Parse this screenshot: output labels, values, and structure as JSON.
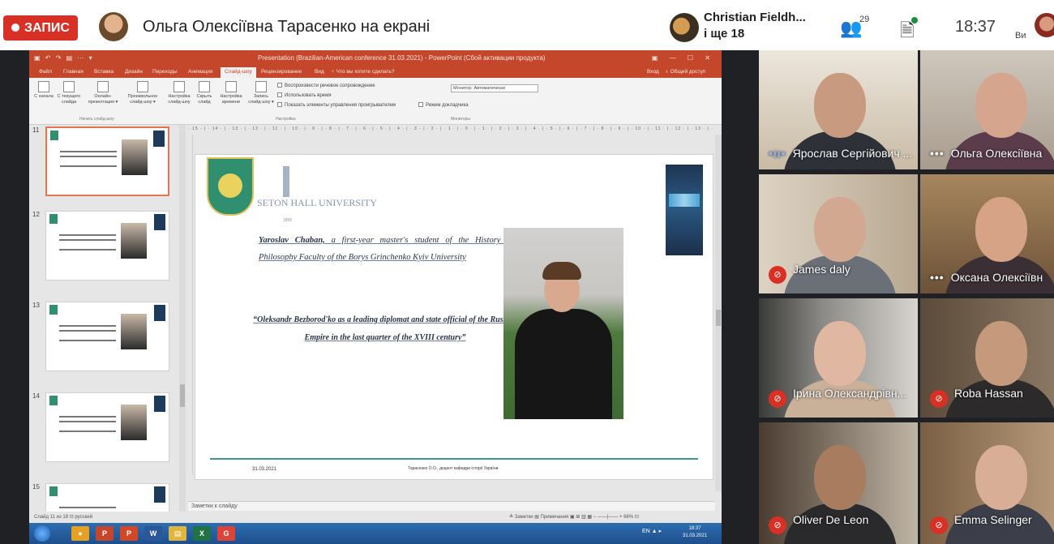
{
  "meet": {
    "recording_label": "ЗАПИС",
    "presenter_title": "Ольга Олексіївна Тарасенко на екрані",
    "pinned_name": "Christian Fieldh...",
    "pinned_more": "і ще 18",
    "participants_count": "29",
    "clock": "18:37",
    "me_label": "Ви"
  },
  "powerpoint": {
    "quick_access": "▣ ↶ ↷ ▤ ⋯ ▾",
    "title": "Presentation (Brazilian-American conference 31.03.2021) - PowerPoint (Сбой активации продукта)",
    "window_controls": "▣ — ☐ ✕",
    "tabs": [
      "Файл",
      "Главная",
      "Вставка",
      "Дизайн",
      "Переходы",
      "Анимация",
      "Слайд-шоу",
      "Рецензирование",
      "Вид",
      "♀ Что вы хотите сделать?"
    ],
    "active_tab": "Слайд-шоу",
    "signin": "Вход",
    "share": "♁ Общий доступ",
    "ribbon_buttons": [
      {
        "label": "С начала"
      },
      {
        "label": "С текущего слайда"
      },
      {
        "label": "Онлайн-презентация ▾"
      },
      {
        "label": "Произвольное слайд-шоу ▾"
      },
      {
        "label": "Настройка слайд-шоу"
      },
      {
        "label": "Скрыть слайд"
      },
      {
        "label": "Настройка времени"
      },
      {
        "label": "Запись слайд-шоу ▾"
      }
    ],
    "group_start": "Начать слайд-шоу",
    "group_setup": "Настройка",
    "group_monitors": "Мониторы",
    "checkboxes": [
      "Воспроизвести речевое сопровождение",
      "Использовать время",
      "Показать элементы управления проигрывателем"
    ],
    "monitor_label": "Монитор: Автоматически",
    "presenter_view": "Режим докладчика",
    "ruler": "· 15 · | · 14 · | · 13 · | · 12 · | · 11 · | · 10 · | · 9 · | · 8 · | · 7 · | · 6 · | · 5 · | · 4 · | · 3 · | · 2 · | · 1 · | · 0 · | · 1 · | · 2 · | · 3 · | · 4 · | · 5 · | · 6 · | · 7 · | · 8 · | · 9 · | · 10 · | · 11 · | · 12 · | · 13 · | · 14 · | · 15 · | · 16 ·",
    "thumb_numbers": [
      "11",
      "12",
      "13",
      "14",
      "15"
    ],
    "notes_placeholder": "Заметки к слайду",
    "status_left": "Слайд 11 из 18    ⊡    русский",
    "status_right": "≜ Заметки   ▤ Примечания   ▣ ⊞ ▥ ▦  −  ——|——  +  66%  ⊡",
    "taskbar_apps": [
      "●",
      "P",
      "P",
      "W",
      "▤",
      "X",
      "G"
    ],
    "tray": "EN  ▲  ▸",
    "tray_time": "18:37",
    "tray_date": "31.03.2021"
  },
  "slide": {
    "university_name": "SETON HALL UNIVERSITY",
    "university_year": "1856",
    "speaker_name": "Yaroslav Chaban,",
    "speaker_text": " a first-year master's student of the History and Philosophy Faculty of the Borys Grinchenko Kyiv University",
    "topic": "“Oleksandr Bezborod'ko as a leading diplomat and state official of the Russian Empire in the last quarter of the XVIII century”",
    "date": "31.03.2021",
    "footer": "Тарасенко О.О., доцент кафедри історії України"
  },
  "participants": [
    {
      "name": "Ярослав Сергійович ...",
      "state": "talking"
    },
    {
      "name": "Ольга Олексіївна",
      "state": "dots"
    },
    {
      "name": "James daly",
      "state": "muted"
    },
    {
      "name": "Оксана Олексіївн",
      "state": "dots"
    },
    {
      "name": "Ірина Олександрівн...",
      "state": "muted"
    },
    {
      "name": "Roba Hassan",
      "state": "muted"
    },
    {
      "name": "Oliver De Leon",
      "state": "muted"
    },
    {
      "name": "Emma Selinger",
      "state": "muted"
    }
  ],
  "colors": {
    "recording": "#d93025",
    "powerpoint_brand": "#c4462b",
    "slide_accent": "#3d9a8a"
  }
}
